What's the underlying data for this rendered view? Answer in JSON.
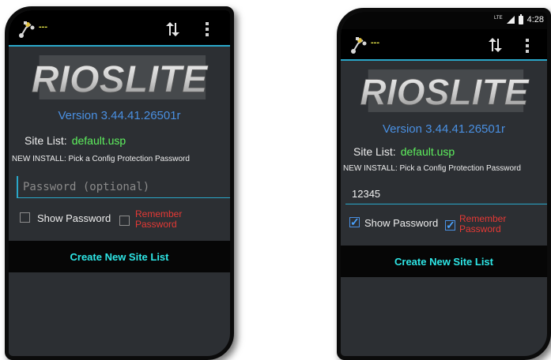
{
  "colors": {
    "accent": "#2aa7c9",
    "version_blue": "#4a90e2",
    "site_file_green": "#5ef05e",
    "remember_red": "#e53935",
    "button_cyan": "#2ee6e6",
    "screen_bg": "#2c2f33"
  },
  "left": {
    "app_dashes": "---",
    "logo_text": "RIOSLITE",
    "version": "Version 3.44.41.26501r",
    "site_list_label": "Site List:",
    "site_list_file": "default.usp",
    "new_install_text": "NEW INSTALL: Pick a Config Protection Password",
    "password_placeholder": "Password (optional)",
    "password_value": "",
    "show_password_label": "Show Password",
    "show_password_checked": false,
    "remember_label_1": "Remember",
    "remember_label_2": "Password",
    "remember_checked": false,
    "create_button": "Create New Site List",
    "icons": [
      "app-icon",
      "sync-icon",
      "overflow-menu-icon"
    ]
  },
  "right": {
    "status_network": "LTE",
    "status_time": "4:28",
    "app_dashes": "---",
    "logo_text": "RIOSLITE",
    "version": "Version 3.44.41.26501r",
    "site_list_label": "Site List:",
    "site_list_file": "default.usp",
    "new_install_text": "NEW INSTALL: Pick a Config Protection Password",
    "password_value": "12345",
    "show_password_label": "Show Password",
    "show_password_checked": true,
    "remember_label_1": "Remember",
    "remember_label_2": "Password",
    "remember_checked": true,
    "create_button": "Create New Site List",
    "icons": [
      "signal-icon",
      "battery-icon",
      "app-icon",
      "sync-icon",
      "overflow-menu-icon"
    ]
  }
}
